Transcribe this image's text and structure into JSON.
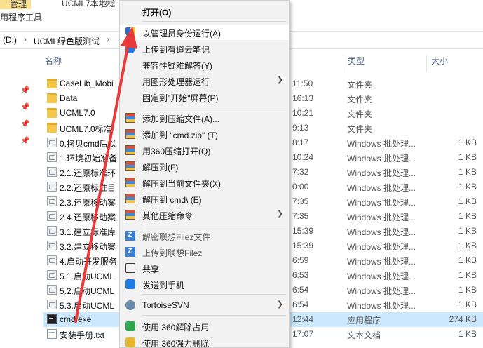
{
  "window": {
    "ribbon_tab_manage": "管理",
    "ribbon_tab_tools": "用程序工具",
    "title": "UCML7本地稳"
  },
  "address": {
    "drive": "(D:)",
    "folder": "UCML绿色版测试"
  },
  "columns": {
    "name": "名称",
    "type": "类型",
    "size": "大小"
  },
  "files": [
    {
      "name": "CaseLib_Mobi",
      "date": "11:50",
      "type": "文件夹",
      "size": "",
      "icon": "folder"
    },
    {
      "name": "Data",
      "date": "16:13",
      "type": "文件夹",
      "size": "",
      "icon": "folder"
    },
    {
      "name": "UCML7.0",
      "date": "10:21",
      "type": "文件夹",
      "size": "",
      "icon": "folder"
    },
    {
      "name": "UCML7.0标准",
      "date": "9:13",
      "type": "文件夹",
      "size": "",
      "icon": "folder"
    },
    {
      "name": "0.拷贝cmd后以",
      "date": "8:17",
      "type": "Windows 批处理...",
      "size": "1 KB",
      "icon": "bat"
    },
    {
      "name": "1.环境初始准备",
      "date": "10:24",
      "type": "Windows 批处理...",
      "size": "1 KB",
      "icon": "bat"
    },
    {
      "name": "2.1.还原标准环",
      "date": "7:32",
      "type": "Windows 批处理...",
      "size": "1 KB",
      "icon": "bat"
    },
    {
      "name": "2.2.还原标准目",
      "date": "0:00",
      "type": "Windows 批处理...",
      "size": "1 KB",
      "icon": "bat"
    },
    {
      "name": "2.3.还原移动案",
      "date": "7:35",
      "type": "Windows 批处理...",
      "size": "1 KB",
      "icon": "bat"
    },
    {
      "name": "2.4.还原移动案",
      "date": "7:35",
      "type": "Windows 批处理...",
      "size": "1 KB",
      "icon": "bat"
    },
    {
      "name": "3.1.建立标准库",
      "date": "15:39",
      "type": "Windows 批处理...",
      "size": "1 KB",
      "icon": "bat"
    },
    {
      "name": "3.2.建立移动案",
      "date": "15:39",
      "type": "Windows 批处理...",
      "size": "1 KB",
      "icon": "bat"
    },
    {
      "name": "4.启动开发服务",
      "date": "6:59",
      "type": "Windows 批处理...",
      "size": "1 KB",
      "icon": "bat"
    },
    {
      "name": "5.1.启动UCML",
      "date": "6:53",
      "type": "Windows 批处理...",
      "size": "1 KB",
      "icon": "bat"
    },
    {
      "name": "5.2.启动UCML",
      "date": "6:54",
      "type": "Windows 批处理...",
      "size": "1 KB",
      "icon": "bat"
    },
    {
      "name": "5.3.启动UCML",
      "date": "6:54",
      "type": "Windows 批处理...",
      "size": "1 KB",
      "icon": "bat"
    },
    {
      "name": "cmd.exe",
      "date": "12:44",
      "type": "应用程序",
      "size": "274 KB",
      "icon": "exe",
      "selected": true
    },
    {
      "name": "安装手册.txt",
      "date": "17:07",
      "type": "文本文档",
      "size": "1 KB",
      "icon": "txt"
    }
  ],
  "menu": {
    "items": [
      {
        "label": "打开(O)",
        "icon": "",
        "bold": true
      },
      {
        "label": "以管理员身份运行(A)",
        "icon": "shield-icon",
        "hover": true
      },
      {
        "label": "上传到有道云笔记",
        "icon": "cloud-note-icon"
      },
      {
        "label": "兼容性疑难解答(Y)",
        "icon": ""
      },
      {
        "label": "用图形处理器运行",
        "icon": "",
        "submenu": true
      },
      {
        "label": "固定到\"开始\"屏幕(P)",
        "icon": ""
      },
      {
        "label": "添加到压缩文件(A)...",
        "icon": "archive-icon"
      },
      {
        "label": "添加到 \"cmd.zip\" (T)",
        "icon": "archive-icon"
      },
      {
        "label": "用360压缩打开(Q)",
        "icon": "archive-icon"
      },
      {
        "label": "解压到(F)",
        "icon": "archive-icon"
      },
      {
        "label": "解压到当前文件夹(X)",
        "icon": "archive-icon"
      },
      {
        "label": "解压到 cmd\\ (E)",
        "icon": "archive-icon"
      },
      {
        "label": "其他压缩命令",
        "icon": "archive-icon",
        "submenu": true
      },
      {
        "label": "解密联想Filez文件",
        "icon": "filez-icon",
        "dim": true
      },
      {
        "label": "上传到联想Filez",
        "icon": "filez-icon",
        "dim": true
      },
      {
        "label": "共享",
        "icon": "share-icon"
      },
      {
        "label": "发送到手机",
        "icon": "phone-icon"
      },
      {
        "label": "TortoiseSVN",
        "icon": "tortoise-svn-icon",
        "submenu": true
      },
      {
        "label": "使用 360解除占用",
        "icon": "unlock-360-icon"
      },
      {
        "label": "使用 360强力删除",
        "icon": "delete-360-icon"
      }
    ]
  },
  "colors": {
    "selection": "#cce8ff",
    "menu_bg": "#f2f2f2",
    "annotation_arrow": "#e83a3a"
  }
}
